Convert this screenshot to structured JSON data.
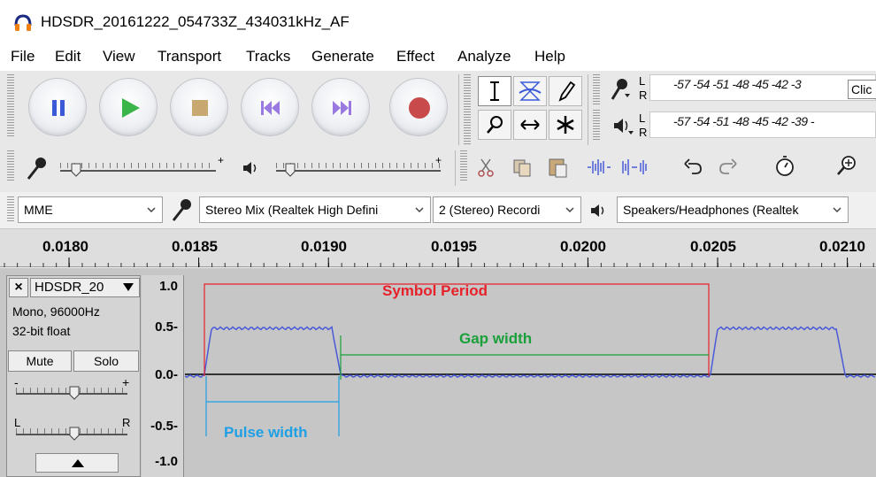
{
  "window": {
    "title": "HDSDR_20161222_054733Z_434031kHz_AF"
  },
  "menu": [
    "File",
    "Edit",
    "View",
    "Transport",
    "Tracks",
    "Generate",
    "Effect",
    "Analyze",
    "Help"
  ],
  "meters": {
    "record_scale": "-57 -54 -51 -48 -45 -42 -3",
    "record_click": "Clic",
    "play_scale": "-57 -54 -51 -48 -45 -42 -39 -",
    "record_channels": "L R",
    "play_channels": "L R"
  },
  "devices": {
    "host": "MME",
    "recording_device": "Stereo Mix (Realtek High Defini",
    "channels": "2 (Stereo) Recordi",
    "playback_device": "Speakers/Headphones (Realtek"
  },
  "ruler": {
    "labels": [
      "0.0180",
      "0.0185",
      "0.0190",
      "0.0195",
      "0.0200",
      "0.0205",
      "0.0210"
    ]
  },
  "track": {
    "name": "HDSDR_20",
    "format": "Mono, 96000Hz",
    "depth": "32-bit float",
    "mute": "Mute",
    "solo": "Solo",
    "gain_minus": "-",
    "gain_plus": "+",
    "pan_left": "L",
    "pan_right": "R",
    "close": "×"
  },
  "amplitude_labels": [
    "1.0",
    "0.5-",
    "0.0-",
    "-0.5-",
    "-1.0"
  ],
  "annotations": {
    "symbol_period": "Symbol Period",
    "gap_width": "Gap width",
    "pulse_width": "Pulse width"
  },
  "colors": {
    "symbol_period": "#e8202a",
    "gap_width": "#1aa03a",
    "pulse_width": "#1ea0e6",
    "waveform": "#4a5ad8"
  }
}
